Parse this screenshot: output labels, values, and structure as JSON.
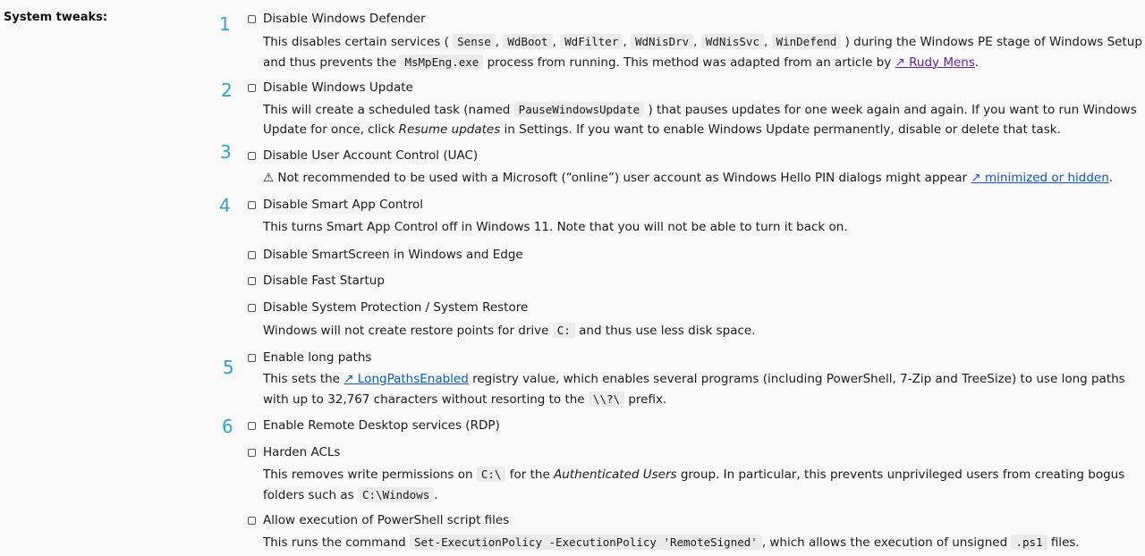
{
  "section": {
    "label": "System tweaks:"
  },
  "annotations": [
    "1",
    "2",
    "3",
    "4",
    "5",
    "6"
  ],
  "options": {
    "defender": {
      "label": "Disable Windows Defender",
      "desc_a": "This disables certain services (",
      "code_sense": "Sense",
      "code_wdboot": "WdBoot",
      "code_wdfilter": "WdFilter",
      "code_wdnisdrv": "WdNisDrv",
      "code_wdnissvc": "WdNisSvc",
      "code_windefend": "WinDefend",
      "desc_b": ") during the Windows PE stage of Windows",
      "desc_c": "Setup and thus prevents the",
      "code_msmpeng": "MsMpEng.exe",
      "desc_d": "process from running. This method was adapted from an article by",
      "link": "↗ Rudy Mens",
      "desc_e": "."
    },
    "update": {
      "label": "Disable Windows Update",
      "desc_a": "This will create a scheduled task (named",
      "code_task": "PauseWindowsUpdate",
      "desc_b": ") that pauses updates for one week again and again. If you want to run",
      "desc_c": "Windows Update for once, click",
      "em_resume": "Resume updates",
      "desc_d": "in Settings. If you want to enable Windows Update permanently, disable or delete that task."
    },
    "uac": {
      "label": "Disable User Account Control (UAC)",
      "desc_a": "⚠ Not recommended to be used with a Microsoft (“online”) user account as Windows Hello PIN dialogs might appear",
      "link": "↗ minimized or hidden",
      "desc_b": "."
    },
    "sac": {
      "label": "Disable Smart App Control",
      "desc": "This turns Smart App Control off in Windows 11. Note that you will not be able to turn it back on."
    },
    "smartscreen": {
      "label": "Disable SmartScreen in Windows and Edge"
    },
    "faststartup": {
      "label": "Disable Fast Startup"
    },
    "restore": {
      "label": "Disable System Protection / System Restore",
      "desc_a": "Windows will not create restore points for drive",
      "code_c": "C:",
      "desc_b": "and thus use less disk space."
    },
    "longpaths": {
      "label": "Enable long paths",
      "desc_a": "This sets the",
      "link": "↗ LongPathsEnabled",
      "desc_b": "registry value, which enables several programs (including PowerShell, 7-Zip and TreeSize) to use long paths with",
      "desc_c": "up to 32,767 characters without resorting to the",
      "code_prefix": "\\\\?\\",
      "desc_d": "prefix."
    },
    "rdp": {
      "label": "Enable Remote Desktop services (RDP)"
    },
    "acl": {
      "label": "Harden ACLs",
      "desc_a": "This removes write permissions on",
      "code_croot": "C:\\",
      "desc_b": "for the",
      "em_auth": "Authenticated Users",
      "desc_c": "group. In particular, this prevents unprivileged users from creating bogus",
      "desc_d": "folders such as",
      "code_cwin": "C:\\Windows",
      "desc_e": "."
    },
    "ps": {
      "label": "Allow execution of PowerShell script files",
      "desc_a": "This runs the command",
      "code_cmd": "Set-ExecutionPolicy -ExecutionPolicy 'RemoteSigned'",
      "desc_b": ", which allows the execution of unsigned",
      "code_ps1": ".ps1",
      "desc_c": "files."
    }
  }
}
